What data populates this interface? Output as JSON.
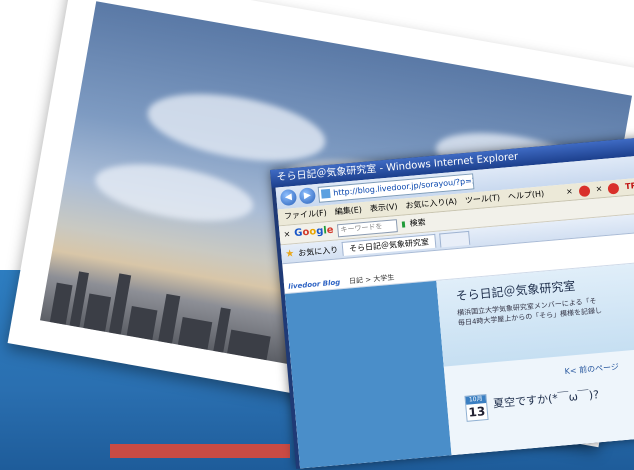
{
  "window": {
    "title": "そら日記＠気象研究室 - Windows Internet Explorer"
  },
  "address": {
    "url": "http://blog.livedoor.jp/sorayou/?p=2"
  },
  "menubar": {
    "items": [
      "ファイル(F)",
      "編集(E)",
      "表示(V)",
      "お気に入り(A)",
      "ツール(T)",
      "ヘルプ(H)"
    ],
    "trend_label": "TREND"
  },
  "googlebar": {
    "close": "×",
    "logo": [
      "G",
      "o",
      "o",
      "g",
      "l",
      "e"
    ],
    "input_placeholder": "キーワードを",
    "search_label": "検索"
  },
  "tabbar": {
    "favorites_label": "お気に入り",
    "active_tab": "そら日記＠気象研究室"
  },
  "blog": {
    "topbar_logo": "livedoor Blog",
    "breadcrumb": "日記 > 大学生",
    "title": "そら日記＠気象研究室",
    "desc_line1": "横浜国立大学気象研究室メンバーによる「そ",
    "desc_line2": "毎日4時大学屋上からの「そら」模様を記録し",
    "prev_page": "K<  前のページ",
    "date_month": "10月",
    "date_day": "13",
    "post_title": "夏空ですか(*￣ω￣)?"
  },
  "colors": {
    "ie_titlebar": "#1c3f8c",
    "sidebar": "#4a8ec9",
    "page_bg_blue": "#2a6fb0",
    "red_strip": "#c94b44"
  }
}
